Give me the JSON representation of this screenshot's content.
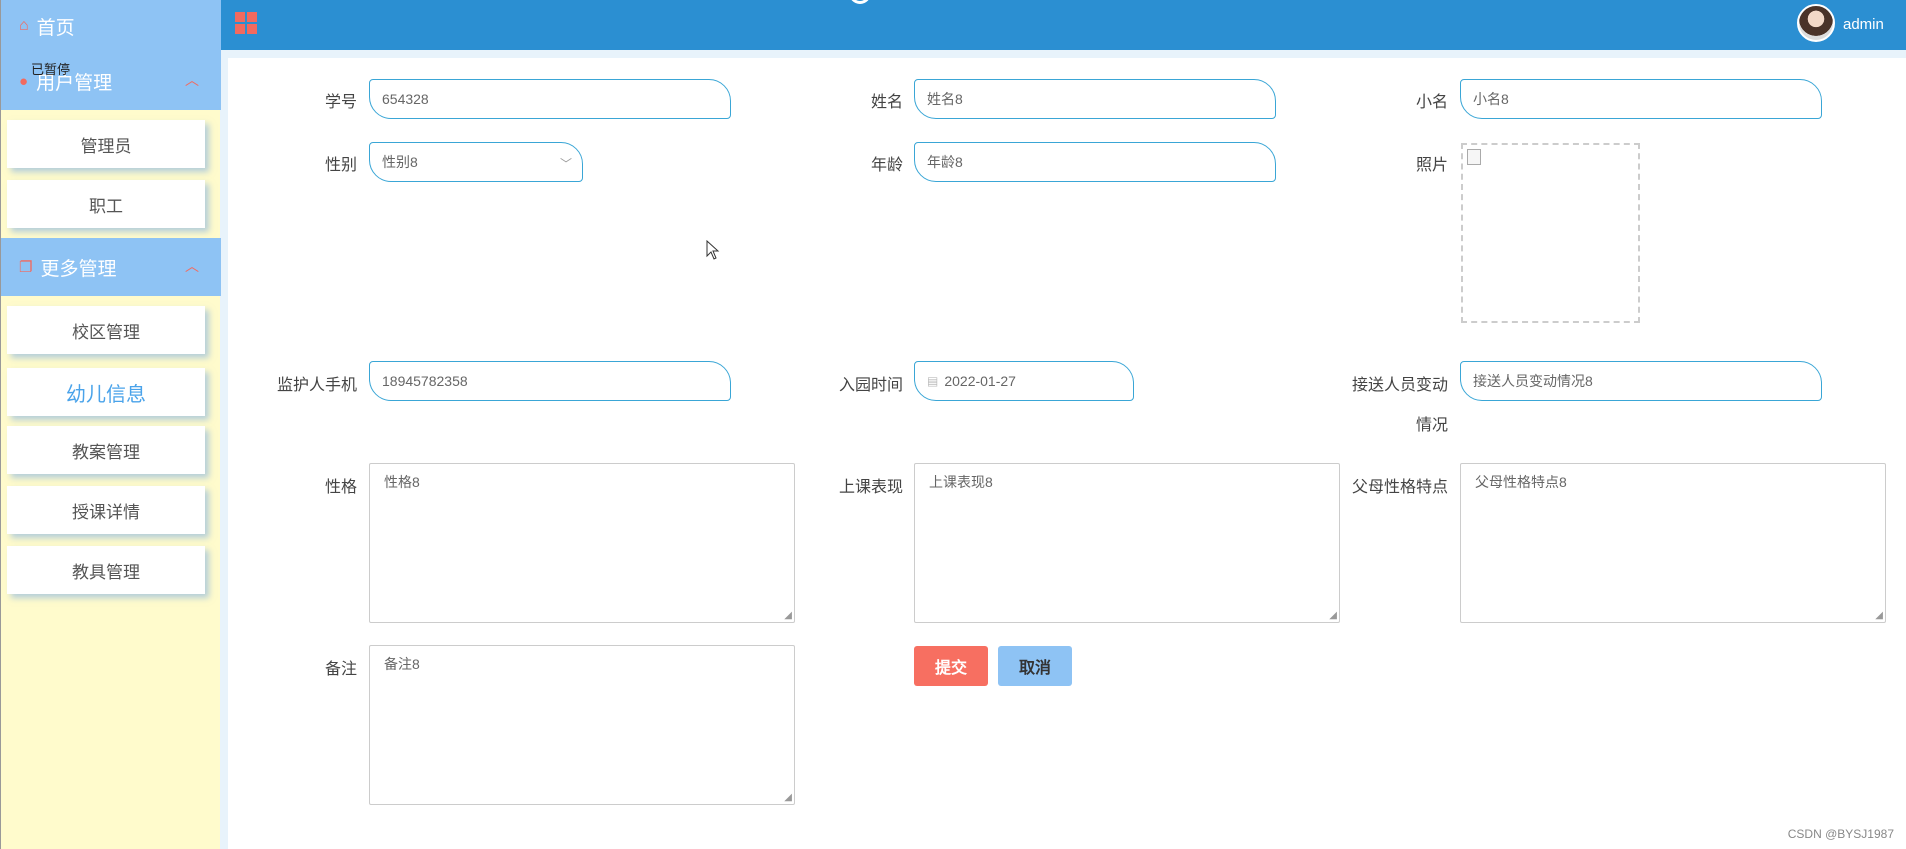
{
  "sidebar": {
    "home_label": "首页",
    "status_tag": "已暂停",
    "groups": [
      {
        "label": "用户管理",
        "items": [
          "管理员",
          "职工"
        ]
      },
      {
        "label": "更多管理",
        "items": [
          "校区管理",
          "幼儿信息",
          "教案管理",
          "授课详情",
          "教具管理"
        ]
      }
    ],
    "active_item": "幼儿信息"
  },
  "header": {
    "username": "admin"
  },
  "form": {
    "student_no": {
      "label": "学号",
      "value": "654328"
    },
    "name": {
      "label": "姓名",
      "value": "姓名8"
    },
    "nickname": {
      "label": "小名",
      "value": "小名8"
    },
    "gender": {
      "label": "性别",
      "value": "性别8"
    },
    "age": {
      "label": "年龄",
      "value": "年龄8"
    },
    "photo": {
      "label": "照片"
    },
    "guardian_phone": {
      "label": "监护人手机",
      "value": "18945782358"
    },
    "enroll_date": {
      "label": "入园时间",
      "value": "2022-01-27"
    },
    "pickup_change": {
      "label_line1": "接送人员变动",
      "label_line2": "情况",
      "value": "接送人员变动情况8"
    },
    "personality": {
      "label": "性格",
      "value": "性格8"
    },
    "class_performance": {
      "label": "上课表现",
      "value": "上课表现8"
    },
    "parent_traits": {
      "label": "父母性格特点",
      "value": "父母性格特点8"
    },
    "remarks": {
      "label": "备注",
      "value": "备注8"
    },
    "submit_label": "提交",
    "cancel_label": "取消"
  },
  "footer": {
    "watermark": "CSDN @BYSJ1987"
  }
}
